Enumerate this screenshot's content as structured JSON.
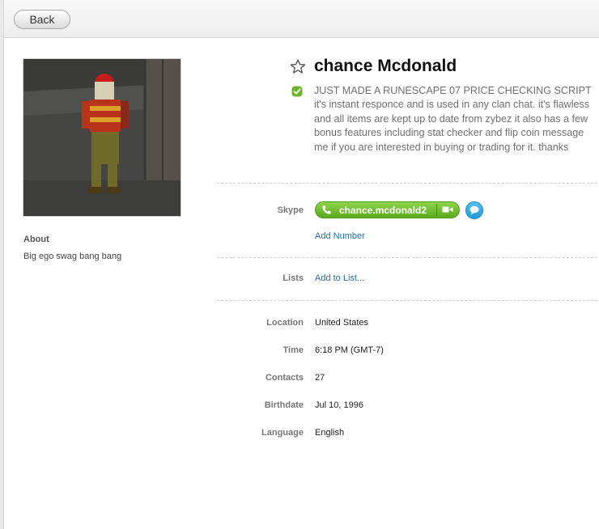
{
  "toolbar": {
    "back_label": "Back"
  },
  "profile": {
    "name": "chance Mcdonald",
    "mood_message": "JUST MADE A RUNESCAPE 07 PRICE CHECKING SCRIPT it's instant responce and is used in any clan chat. it's flawless and all items are kept up to date from zybez it also has a few bonus features including stat checker and flip coin message me if you are interested in buying or trading for it. thanks",
    "status": "online",
    "about_heading": "About",
    "about_text": "Big ego swag bang bang"
  },
  "skype": {
    "label": "Skype",
    "handle": "chance.mcdonald2",
    "add_number": "Add Number"
  },
  "lists": {
    "label": "Lists",
    "add_to_list": "Add to List..."
  },
  "details": {
    "location_label": "Location",
    "location": "United States",
    "time_label": "Time",
    "time": "6:18 PM (GMT-7)",
    "contacts_label": "Contacts",
    "contacts": "27",
    "birthdate_label": "Birthdate",
    "birthdate": "Jul 10, 1996",
    "language_label": "Language",
    "language": "English"
  },
  "icons": {
    "star": "star-outline-icon",
    "status": "online-status-icon",
    "call": "phone-icon",
    "video": "video-camera-icon",
    "chat": "chat-bubble-icon"
  },
  "colors": {
    "call_green": "#5aa91e",
    "chat_blue": "#1f98d8",
    "link_blue": "#1e6fa8",
    "online_green": "#6cb52d"
  }
}
